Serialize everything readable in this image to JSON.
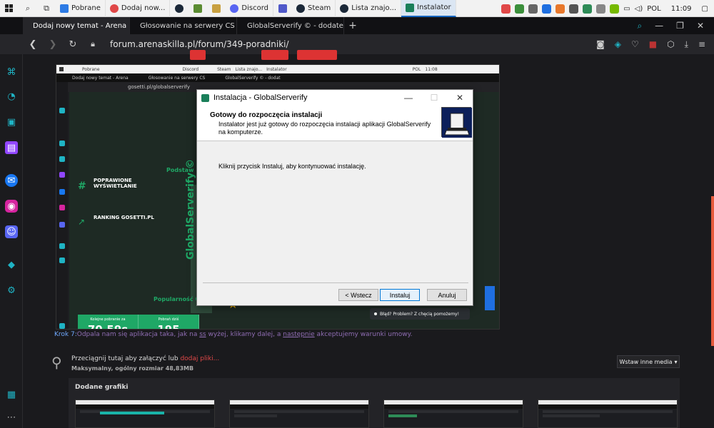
{
  "taskbar": {
    "items": [
      {
        "label": "Pobrane",
        "color": "#2d7be5"
      },
      {
        "label": "Dodaj now...",
        "color": "#e04848"
      },
      {
        "label": "Discord",
        "color": "#5865f2"
      },
      {
        "label": "Steam",
        "color": "#1b2838"
      },
      {
        "label": "Lista znajo...",
        "color": "#1b2838"
      },
      {
        "label": "Instalator",
        "color": "#1a7f5a"
      }
    ],
    "lang": "POL",
    "time": "11:09"
  },
  "browser": {
    "tabs": [
      {
        "label": "Dodaj nowy temat - Arena"
      },
      {
        "label": "Głosowanie na serwery CS"
      },
      {
        "label": "GlobalServerify © - dodate"
      }
    ],
    "url": "forum.arenaskilla.pl/forum/349-poradniki/"
  },
  "embedded": {
    "taskbar_items": [
      "Pobrane",
      "Discord",
      "Steam",
      "Lista znajo...",
      "Instalator"
    ],
    "taskbar_lang": "POL",
    "taskbar_time": "11:08",
    "tabs": [
      "Dodaj nowy temat - Arena",
      "Głosowanie na serwery CS",
      "GlobalServerify © - dodat"
    ],
    "url": "gosetti.pl/globalserverify",
    "feature1_title": "POPRAWIONE WYŚWIETLANIE",
    "feature2_title": "RANKING GOSETTI.PL",
    "podstaw": "Podstaw",
    "brand": "GlobalServerify ©",
    "popularnosc": "Popularność Gl",
    "stat1_label": "Kolejne pobranie za",
    "stat1_value": "70,59s",
    "stat2_label": "Pobrań dziś",
    "stat2_value": "195",
    "help": "Błąd? Problem? Z chęcią pomożemy!"
  },
  "installer": {
    "title": "Instalacja - GlobalServerify",
    "heading": "Gotowy do rozpoczęcia instalacji",
    "subheading": "Instalator jest już gotowy do rozpoczęcia instalacji aplikacji GlobalServerify na komputerze.",
    "message": "Kliknij przycisk Instaluj, aby kontynuować instalację.",
    "back_label": "< Wstecz",
    "install_label": "Instaluj",
    "cancel_label": "Anuluj"
  },
  "post": {
    "caption_step": "Krok 7:",
    "caption_text1": "Odpala nam się aplikacja taka, jak na ",
    "caption_ss": "ss",
    "caption_text2": " wyżej, klikamy dalej, a ",
    "caption_nast": "następnie",
    "caption_text3": " akceptujemy warunki umowy."
  },
  "attach": {
    "drop_text": "Przeciągnij tutaj aby załączyć lub ",
    "drop_link": "dodaj pliki...",
    "max_size": "Maksymalny, ogólny rozmiar 48,83MB",
    "insert_media": "Wstaw inne media",
    "added_title": "Dodane grafiki"
  }
}
